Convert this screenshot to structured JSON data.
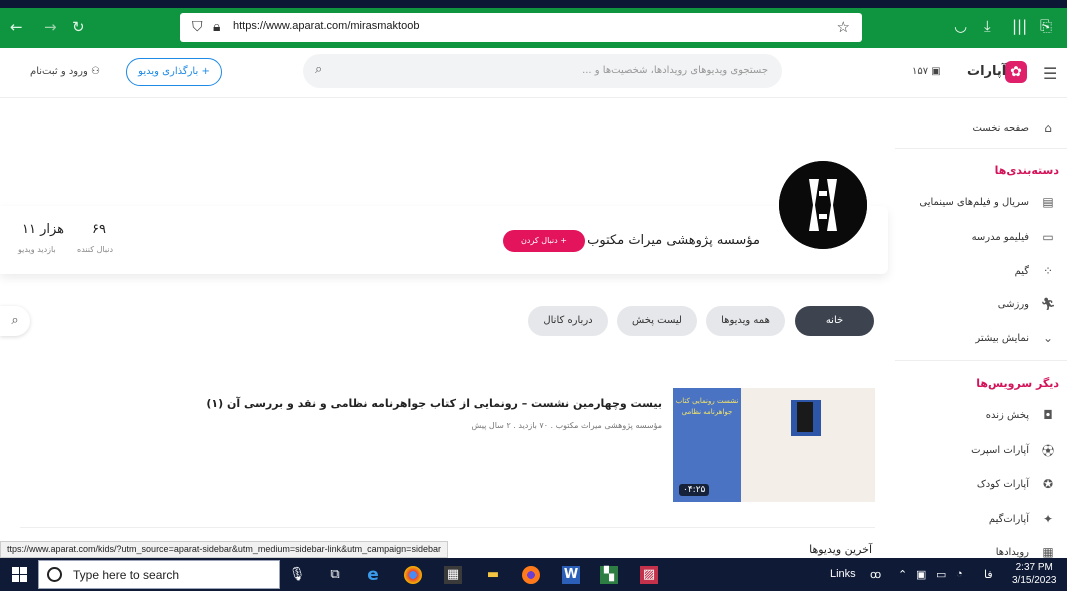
{
  "browser": {
    "url": "https://www.aparat.com/mirasmaktoob"
  },
  "header": {
    "logo_text": "آپارات",
    "counter": "۱۵۷",
    "search_placeholder": "جستجوی ویدیوهای رویدادها، شخصیت‌ها و ...",
    "upload_label": "+ بارگذاری ویدیو",
    "login_label": "ورود و ثبت‌نام"
  },
  "sidebar": {
    "home": "صفحه نخست",
    "categories_title": "دسته‌بندی‌ها",
    "categories": [
      {
        "label": "سریال و فیلم‌های سینمایی",
        "icon": "film-icon"
      },
      {
        "label": "فیلیمو مدرسه",
        "icon": "school-icon"
      },
      {
        "label": "گیم",
        "icon": "game-icon"
      },
      {
        "label": "ورزشی",
        "icon": "sport-icon"
      },
      {
        "label": "نمایش بیشتر",
        "icon": "chevron-down-icon"
      }
    ],
    "services_title": "دیگر سرویس‌ها",
    "services": [
      {
        "label": "پخش زنده",
        "icon": "live-icon"
      },
      {
        "label": "آپارات اسپرت",
        "icon": "sport-ball-icon"
      },
      {
        "label": "آپارات کودک",
        "icon": "kids-icon"
      },
      {
        "label": "آپارات‌گیم",
        "icon": "gamepad-icon"
      },
      {
        "label": "رویدادها",
        "icon": "calendar-icon"
      }
    ]
  },
  "channel": {
    "name": "مؤسسه پژوهشی میراث مکتوب",
    "follow_label": "+ دنبال کردن",
    "followers_count": "۶۹",
    "followers_label": "دنبال کننده",
    "views_count": "۱۱ هزار",
    "views_label": "بازدید ویدیو"
  },
  "tabs": [
    "خانه",
    "همه ویدیوها",
    "لیست پخش",
    "درباره کانال"
  ],
  "video": {
    "title": "بیست وچهارمین نشست – رونمایی از کتاب جواهرنامه نظامی و نقد و بررسی آن (۱)",
    "meta": "مؤسسه پژوهشی میراث مکتوب . ۷۰ بازدید . ۲ سال پیش",
    "duration": "۰۴:۲۵",
    "poster_text": "نشست رونمایی کتاب جواهرنامه نظامی"
  },
  "latest_label": "آخرین ویدیوها",
  "status_url": "ttps://www.aparat.com/kids/?utm_source=aparat-sidebar&utm_medium=sidebar-link&utm_campaign=sidebar",
  "taskbar": {
    "search_placeholder": "Type here to search",
    "links_label": "Links",
    "lang": "فا",
    "time": "2:37 PM",
    "date": "3/15/2023"
  }
}
